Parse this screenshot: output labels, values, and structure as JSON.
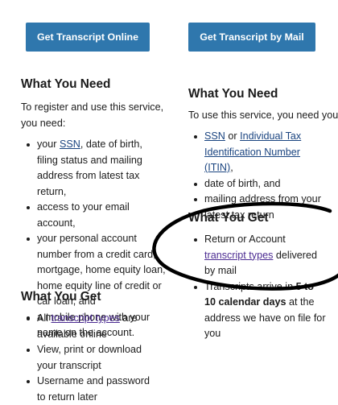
{
  "left": {
    "button_label": "Get Transcript Online",
    "need_heading": "What You Need",
    "need_intro": "To register and use this service, you need:",
    "need_items": [
      {
        "link": "SSN",
        "rest": ", date of birth, filing status and mailing address from latest tax return,"
      },
      {
        "text": "access to your email account,"
      },
      {
        "text": "your personal account number from a credit card, mortgage, home equity loan, home equity line of credit or car loan, and"
      },
      {
        "text": "a mobile phone with your name on the account."
      }
    ],
    "get_heading": "What You Get",
    "get_items": [
      {
        "pre": "All ",
        "link": "transcript types",
        "rest": " are available online"
      },
      {
        "text": "View, print or download your transcript"
      },
      {
        "text": "Username and password to return later"
      }
    ]
  },
  "right": {
    "button_label": "Get Transcript by Mail",
    "need_heading": "What You Need",
    "need_intro": "To use this service, you need your:",
    "need_items": [
      {
        "link1": "SSN",
        "mid": " or ",
        "link2": "Individual Tax Identification Number (ITIN)",
        "rest": ","
      },
      {
        "text": "date of birth, and"
      },
      {
        "text": "mailing address from your latest tax return"
      }
    ],
    "get_heading": "What You Get",
    "get_items": [
      {
        "pre": "Return or Account ",
        "link": "transcript types",
        "rest": " delivered by mail"
      },
      {
        "pre": "Transcripts arrive in ",
        "bold": "5 to 10 calendar days",
        "rest": " at the address we have on file for you"
      }
    ]
  },
  "colors": {
    "button": "#2f77ad",
    "link": "#1a4480",
    "visited_link": "#4c2c92",
    "annotation": "#000000"
  }
}
